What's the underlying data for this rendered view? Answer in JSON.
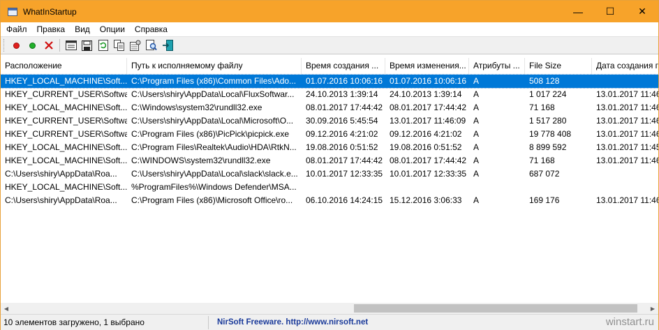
{
  "window": {
    "title": "WhatInStartup",
    "controls": {
      "minimize": "—",
      "maximize": "☐",
      "close": "✕"
    }
  },
  "menu": [
    "Файл",
    "Правка",
    "Вид",
    "Опции",
    "Справка"
  ],
  "toolbar": {
    "icons": [
      "red-dot-icon",
      "green-dot-icon",
      "red-x-icon",
      "properties-icon",
      "save-icon",
      "refresh-icon",
      "copy-icon",
      "options-icon",
      "find-icon",
      "exit-icon"
    ],
    "colors": {
      "red": "#e0201e",
      "green": "#21b02a"
    }
  },
  "columns": [
    "Расположение",
    "Путь к исполняемому файлу",
    "Время создания ...",
    "Время изменения...",
    "Атрибуты ...",
    "File Size",
    "Дата создания г"
  ],
  "rows": [
    [
      "HKEY_LOCAL_MACHINE\\Soft...",
      "C:\\Program Files (x86)\\Common Files\\Ado...",
      "01.07.2016 10:06:16",
      "01.07.2016 10:06:16",
      "A",
      "508 128",
      ""
    ],
    [
      "HKEY_CURRENT_USER\\Softwa...",
      "C:\\Users\\shiry\\AppData\\Local\\FluxSoftwar...",
      "24.10.2013 1:39:14",
      "24.10.2013 1:39:14",
      "A",
      "1 017 224",
      "13.01.2017 11:46"
    ],
    [
      "HKEY_LOCAL_MACHINE\\Soft...",
      "C:\\Windows\\system32\\rundll32.exe",
      "08.01.2017 17:44:42",
      "08.01.2017 17:44:42",
      "A",
      "71 168",
      "13.01.2017 11:46"
    ],
    [
      "HKEY_CURRENT_USER\\Softwa...",
      "C:\\Users\\shiry\\AppData\\Local\\Microsoft\\O...",
      "30.09.2016 5:45:54",
      "13.01.2017 11:46:09",
      "A",
      "1 517 280",
      "13.01.2017 11:46"
    ],
    [
      "HKEY_CURRENT_USER\\Softwa...",
      "C:\\Program Files (x86)\\PicPick\\picpick.exe",
      "09.12.2016 4:21:02",
      "09.12.2016 4:21:02",
      "A",
      "19 778 408",
      "13.01.2017 11:46"
    ],
    [
      "HKEY_LOCAL_MACHINE\\Soft...",
      "C:\\Program Files\\Realtek\\Audio\\HDA\\RtkN...",
      "19.08.2016 0:51:52",
      "19.08.2016 0:51:52",
      "A",
      "8 899 592",
      "13.01.2017 11:45"
    ],
    [
      "HKEY_LOCAL_MACHINE\\Soft...",
      "C:\\WINDOWS\\system32\\rundll32.exe",
      "08.01.2017 17:44:42",
      "08.01.2017 17:44:42",
      "A",
      "71 168",
      "13.01.2017 11:46"
    ],
    [
      "C:\\Users\\shiry\\AppData\\Roa...",
      "C:\\Users\\shiry\\AppData\\Local\\slack\\slack.e...",
      "10.01.2017 12:33:35",
      "10.01.2017 12:33:35",
      "A",
      "687 072",
      ""
    ],
    [
      "HKEY_LOCAL_MACHINE\\Soft...",
      "%ProgramFiles%\\Windows Defender\\MSA...",
      "",
      "",
      "",
      "",
      ""
    ],
    [
      "C:\\Users\\shiry\\AppData\\Roa...",
      "C:\\Program Files (x86)\\Microsoft Office\\ro...",
      "06.10.2016 14:24:15",
      "15.12.2016 3:06:33",
      "A",
      "169 176",
      "13.01.2017 11:46"
    ]
  ],
  "selected_row": 0,
  "status": {
    "left": "10 элементов загружено, 1 выбрано",
    "link": "NirSoft Freeware.  http://www.nirsoft.net"
  },
  "watermark": "winstart.ru",
  "colors": {
    "titlebar": "#f7a32a",
    "selection": "#0078d7",
    "link": "#1a3a9a"
  }
}
